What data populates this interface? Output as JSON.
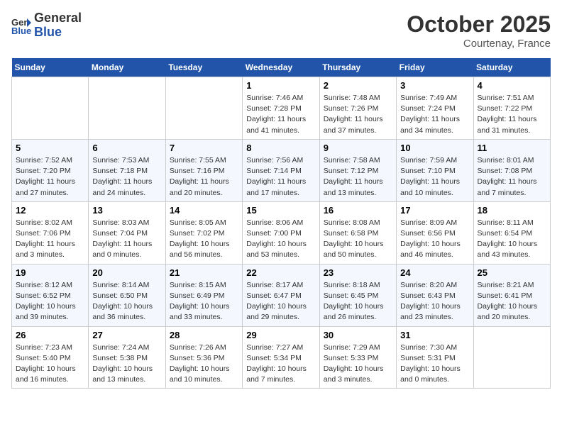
{
  "header": {
    "logo_general": "General",
    "logo_blue": "Blue",
    "month": "October 2025",
    "location": "Courtenay, France"
  },
  "days_of_week": [
    "Sunday",
    "Monday",
    "Tuesday",
    "Wednesday",
    "Thursday",
    "Friday",
    "Saturday"
  ],
  "weeks": [
    [
      {
        "day": "",
        "info": ""
      },
      {
        "day": "",
        "info": ""
      },
      {
        "day": "",
        "info": ""
      },
      {
        "day": "1",
        "info": "Sunrise: 7:46 AM\nSunset: 7:28 PM\nDaylight: 11 hours and 41 minutes."
      },
      {
        "day": "2",
        "info": "Sunrise: 7:48 AM\nSunset: 7:26 PM\nDaylight: 11 hours and 37 minutes."
      },
      {
        "day": "3",
        "info": "Sunrise: 7:49 AM\nSunset: 7:24 PM\nDaylight: 11 hours and 34 minutes."
      },
      {
        "day": "4",
        "info": "Sunrise: 7:51 AM\nSunset: 7:22 PM\nDaylight: 11 hours and 31 minutes."
      }
    ],
    [
      {
        "day": "5",
        "info": "Sunrise: 7:52 AM\nSunset: 7:20 PM\nDaylight: 11 hours and 27 minutes."
      },
      {
        "day": "6",
        "info": "Sunrise: 7:53 AM\nSunset: 7:18 PM\nDaylight: 11 hours and 24 minutes."
      },
      {
        "day": "7",
        "info": "Sunrise: 7:55 AM\nSunset: 7:16 PM\nDaylight: 11 hours and 20 minutes."
      },
      {
        "day": "8",
        "info": "Sunrise: 7:56 AM\nSunset: 7:14 PM\nDaylight: 11 hours and 17 minutes."
      },
      {
        "day": "9",
        "info": "Sunrise: 7:58 AM\nSunset: 7:12 PM\nDaylight: 11 hours and 13 minutes."
      },
      {
        "day": "10",
        "info": "Sunrise: 7:59 AM\nSunset: 7:10 PM\nDaylight: 11 hours and 10 minutes."
      },
      {
        "day": "11",
        "info": "Sunrise: 8:01 AM\nSunset: 7:08 PM\nDaylight: 11 hours and 7 minutes."
      }
    ],
    [
      {
        "day": "12",
        "info": "Sunrise: 8:02 AM\nSunset: 7:06 PM\nDaylight: 11 hours and 3 minutes."
      },
      {
        "day": "13",
        "info": "Sunrise: 8:03 AM\nSunset: 7:04 PM\nDaylight: 11 hours and 0 minutes."
      },
      {
        "day": "14",
        "info": "Sunrise: 8:05 AM\nSunset: 7:02 PM\nDaylight: 10 hours and 56 minutes."
      },
      {
        "day": "15",
        "info": "Sunrise: 8:06 AM\nSunset: 7:00 PM\nDaylight: 10 hours and 53 minutes."
      },
      {
        "day": "16",
        "info": "Sunrise: 8:08 AM\nSunset: 6:58 PM\nDaylight: 10 hours and 50 minutes."
      },
      {
        "day": "17",
        "info": "Sunrise: 8:09 AM\nSunset: 6:56 PM\nDaylight: 10 hours and 46 minutes."
      },
      {
        "day": "18",
        "info": "Sunrise: 8:11 AM\nSunset: 6:54 PM\nDaylight: 10 hours and 43 minutes."
      }
    ],
    [
      {
        "day": "19",
        "info": "Sunrise: 8:12 AM\nSunset: 6:52 PM\nDaylight: 10 hours and 39 minutes."
      },
      {
        "day": "20",
        "info": "Sunrise: 8:14 AM\nSunset: 6:50 PM\nDaylight: 10 hours and 36 minutes."
      },
      {
        "day": "21",
        "info": "Sunrise: 8:15 AM\nSunset: 6:49 PM\nDaylight: 10 hours and 33 minutes."
      },
      {
        "day": "22",
        "info": "Sunrise: 8:17 AM\nSunset: 6:47 PM\nDaylight: 10 hours and 29 minutes."
      },
      {
        "day": "23",
        "info": "Sunrise: 8:18 AM\nSunset: 6:45 PM\nDaylight: 10 hours and 26 minutes."
      },
      {
        "day": "24",
        "info": "Sunrise: 8:20 AM\nSunset: 6:43 PM\nDaylight: 10 hours and 23 minutes."
      },
      {
        "day": "25",
        "info": "Sunrise: 8:21 AM\nSunset: 6:41 PM\nDaylight: 10 hours and 20 minutes."
      }
    ],
    [
      {
        "day": "26",
        "info": "Sunrise: 7:23 AM\nSunset: 5:40 PM\nDaylight: 10 hours and 16 minutes."
      },
      {
        "day": "27",
        "info": "Sunrise: 7:24 AM\nSunset: 5:38 PM\nDaylight: 10 hours and 13 minutes."
      },
      {
        "day": "28",
        "info": "Sunrise: 7:26 AM\nSunset: 5:36 PM\nDaylight: 10 hours and 10 minutes."
      },
      {
        "day": "29",
        "info": "Sunrise: 7:27 AM\nSunset: 5:34 PM\nDaylight: 10 hours and 7 minutes."
      },
      {
        "day": "30",
        "info": "Sunrise: 7:29 AM\nSunset: 5:33 PM\nDaylight: 10 hours and 3 minutes."
      },
      {
        "day": "31",
        "info": "Sunrise: 7:30 AM\nSunset: 5:31 PM\nDaylight: 10 hours and 0 minutes."
      },
      {
        "day": "",
        "info": ""
      }
    ]
  ]
}
